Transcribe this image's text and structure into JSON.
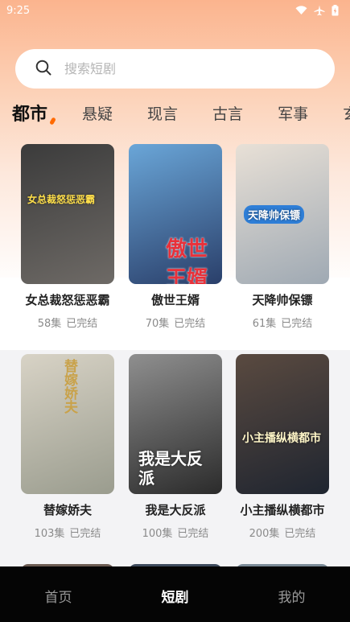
{
  "status_bar": {
    "time": "9:25"
  },
  "search": {
    "placeholder": "搜索短剧"
  },
  "tabs": [
    {
      "label": "都市",
      "active": true
    },
    {
      "label": "悬疑"
    },
    {
      "label": "现言"
    },
    {
      "label": "古言"
    },
    {
      "label": "军事"
    },
    {
      "label": "玄幻"
    }
  ],
  "dramas": [
    {
      "title": "女总裁怒惩恶霸",
      "episodes": "58集",
      "status": "已完结",
      "poster_text": "女总裁怒惩恶霸",
      "colors": [
        "#3b3b3b",
        "#6e6a66"
      ]
    },
    {
      "title": "傲世王婿",
      "episodes": "70集",
      "status": "已完结",
      "poster_text": "傲世王婿",
      "colors": [
        "#6aa6d8",
        "#2a3f6a"
      ]
    },
    {
      "title": "天降帅保镖",
      "episodes": "61集",
      "status": "已完结",
      "poster_text": "天降帅保镖",
      "colors": [
        "#e8e0d6",
        "#9fa9b3"
      ]
    },
    {
      "title": "替嫁娇夫",
      "episodes": "103集",
      "status": "已完结",
      "poster_text": "替嫁娇夫",
      "colors": [
        "#d8d3c6",
        "#9a9c8e"
      ]
    },
    {
      "title": "我是大反派",
      "episodes": "100集",
      "status": "已完结",
      "poster_text": "我是大反派",
      "colors": [
        "#8f8f8f",
        "#2b2b2b"
      ]
    },
    {
      "title": "小主播纵横都市",
      "episodes": "200集",
      "status": "已完结",
      "poster_text": "小主播纵横都市",
      "colors": [
        "#5a4a40",
        "#1f2530"
      ]
    }
  ],
  "bottom_nav": [
    {
      "label": "首页"
    },
    {
      "label": "短剧",
      "active": true
    },
    {
      "label": "我的"
    }
  ]
}
